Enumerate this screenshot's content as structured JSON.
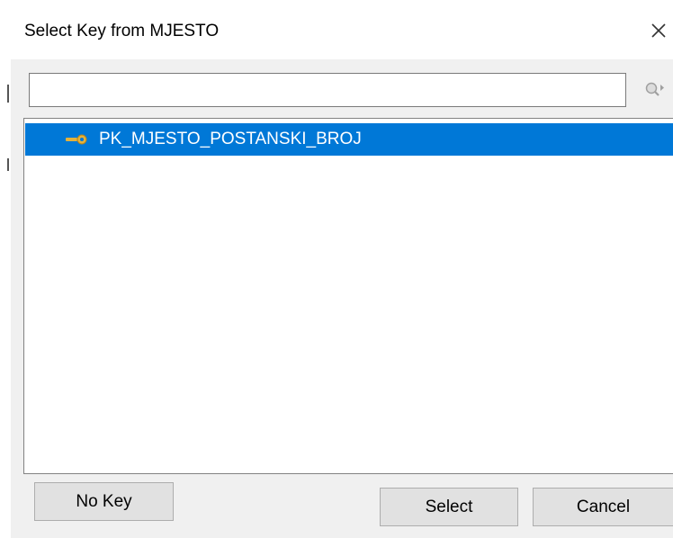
{
  "window": {
    "title": "Select Key from MJESTO",
    "close_icon": "close-icon"
  },
  "search": {
    "value": "",
    "placeholder": "",
    "icon": "search-icon"
  },
  "keys": [
    {
      "label": "PK_MJESTO_POSTANSKI_BROJ",
      "icon": "key-icon",
      "selected": true
    }
  ],
  "buttons": {
    "no_key_label": "No Key",
    "select_label": "Select",
    "cancel_label": "Cancel"
  },
  "colors": {
    "selection": "#0078d7",
    "key_icon": "#e3b23c"
  }
}
